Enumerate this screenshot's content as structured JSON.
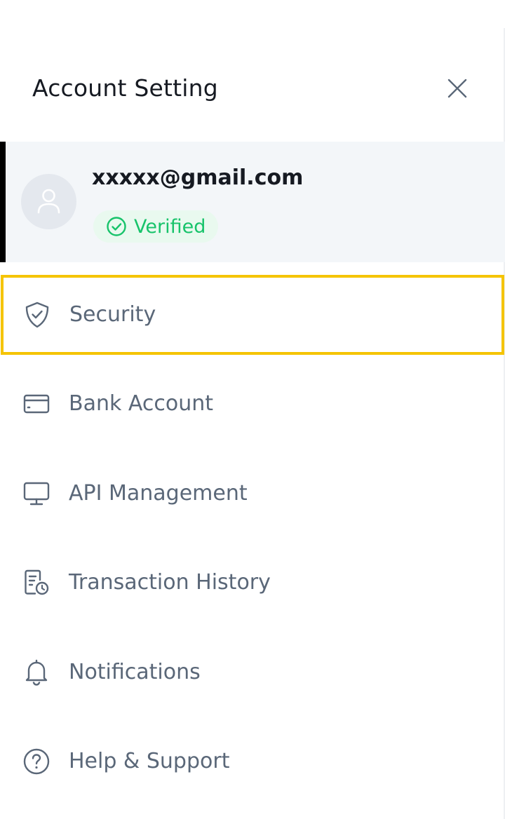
{
  "header": {
    "title": "Account Setting"
  },
  "profile": {
    "email": "xxxxx@gmail.com",
    "status": "Verified"
  },
  "menu": [
    {
      "label": "Security",
      "icon": "shield-check-icon",
      "active": true
    },
    {
      "label": "Bank Account",
      "icon": "card-icon"
    },
    {
      "label": "API Management",
      "icon": "monitor-icon"
    },
    {
      "label": "Transaction History",
      "icon": "receipt-clock-icon"
    },
    {
      "label": "Notifications",
      "icon": "bell-icon"
    },
    {
      "label": "Help & Support",
      "icon": "help-circle-icon"
    }
  ],
  "colors": {
    "accent_outline": "#f5c400",
    "verified_green": "#17c36a",
    "profile_bg": "#f3f6f9",
    "menu_text": "#5a6778"
  }
}
